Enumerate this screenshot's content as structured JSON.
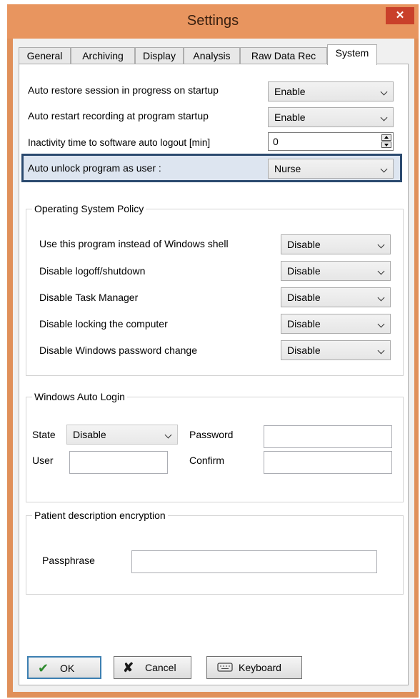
{
  "window": {
    "title": "Settings",
    "close_glyph": "✕"
  },
  "tabs": [
    {
      "label": "General",
      "active": false
    },
    {
      "label": "Archiving",
      "active": false
    },
    {
      "label": "Display",
      "active": false
    },
    {
      "label": "Analysis",
      "active": false
    },
    {
      "label": "Raw Data Rec",
      "active": false
    },
    {
      "label": "System",
      "active": true
    }
  ],
  "system": {
    "auto_restore": {
      "label": "Auto restore session in progress on startup",
      "value": "Enable"
    },
    "auto_restart": {
      "label": "Auto restart recording at program startup",
      "value": "Enable"
    },
    "inactivity": {
      "label": "Inactivity time to software auto logout [min]",
      "value": "0"
    },
    "auto_unlock": {
      "label": "Auto unlock program as user :",
      "value": "Nurse"
    }
  },
  "os_policy": {
    "title": "Operating System Policy",
    "items": [
      {
        "label": "Use this program instead of Windows shell",
        "value": "Disable"
      },
      {
        "label": "Disable logoff/shutdown",
        "value": "Disable"
      },
      {
        "label": "Disable Task Manager",
        "value": "Disable"
      },
      {
        "label": "Disable locking the computer",
        "value": "Disable"
      },
      {
        "label": "Disable Windows password change",
        "value": "Disable"
      }
    ]
  },
  "auto_login": {
    "title": "Windows Auto Login",
    "state_label": "State",
    "state_value": "Disable",
    "user_label": "User",
    "user_value": "",
    "password_label": "Password",
    "password_value": "",
    "confirm_label": "Confirm",
    "confirm_value": ""
  },
  "encryption": {
    "title": "Patient description encryption",
    "passphrase_label": "Passphrase",
    "passphrase_value": ""
  },
  "buttons": {
    "ok": "OK",
    "cancel": "Cancel",
    "keyboard": "Keyboard"
  },
  "icons": {
    "ok": "check-icon",
    "cancel": "x-icon",
    "keyboard": "keyboard-icon"
  },
  "colors": {
    "titlebar": "#e8955f",
    "close": "#c9402a",
    "highlight_border": "#2b4a6f",
    "highlight_fill": "#dde5f0",
    "ok_check": "#2d8a2d",
    "cancel_x": "#1a1a1a"
  }
}
